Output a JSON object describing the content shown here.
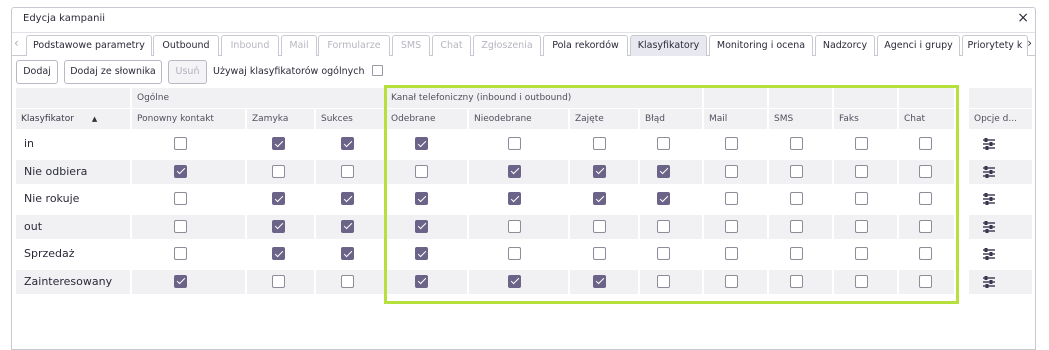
{
  "dialog": {
    "title": "Edycja kampanii",
    "close_symbol": "×"
  },
  "tabs": {
    "nav_left": "‹",
    "nav_right": "›",
    "items": [
      {
        "label": "Podstawowe parametry",
        "disabled": false,
        "active": false
      },
      {
        "label": "Outbound",
        "disabled": false,
        "active": false
      },
      {
        "label": "Inbound",
        "disabled": true,
        "active": false
      },
      {
        "label": "Mail",
        "disabled": true,
        "active": false
      },
      {
        "label": "Formularze",
        "disabled": true,
        "active": false
      },
      {
        "label": "SMS",
        "disabled": true,
        "active": false
      },
      {
        "label": "Chat",
        "disabled": true,
        "active": false
      },
      {
        "label": "Zgłoszenia",
        "disabled": true,
        "active": false
      },
      {
        "label": "Pola rekordów",
        "disabled": false,
        "active": false
      },
      {
        "label": "Klasyfikatory",
        "disabled": false,
        "active": true
      },
      {
        "label": "Monitoring i ocena",
        "disabled": false,
        "active": false
      },
      {
        "label": "Nadzorcy",
        "disabled": false,
        "active": false
      },
      {
        "label": "Agenci i grupy",
        "disabled": false,
        "active": false
      },
      {
        "label": "Priorytety k",
        "disabled": false,
        "active": false
      }
    ]
  },
  "toolbar": {
    "add_label": "Dodaj",
    "add_from_dict_label": "Dodaj ze słownika",
    "delete_label": "Usuń",
    "use_general_label": "Używaj klasyfikatorów ogólnych",
    "use_general_checked": false
  },
  "table": {
    "group_general": "Ogólne",
    "group_phone": "Kanał telefoniczny (inbound i outbound)",
    "sort_symbol": "▲",
    "columns": [
      "Klasyfikator",
      "Ponowny kontakt",
      "Zamyka",
      "Sukces",
      "Odebrane",
      "Nieodebrane",
      "Zajęte",
      "Błąd",
      "Mail",
      "SMS",
      "Faks",
      "Chat",
      "Opcje d..."
    ],
    "rows": [
      {
        "name": "in",
        "checks": [
          false,
          true,
          true,
          true,
          false,
          false,
          false,
          false,
          false,
          false,
          false
        ]
      },
      {
        "name": "Nie odbiera",
        "checks": [
          true,
          false,
          false,
          false,
          true,
          true,
          true,
          false,
          false,
          false,
          false
        ]
      },
      {
        "name": "Nie rokuje",
        "checks": [
          false,
          true,
          true,
          true,
          true,
          true,
          true,
          false,
          false,
          false,
          false
        ]
      },
      {
        "name": "out",
        "checks": [
          false,
          true,
          true,
          true,
          false,
          false,
          false,
          false,
          false,
          false,
          false
        ]
      },
      {
        "name": "Sprzedaż",
        "checks": [
          false,
          true,
          true,
          true,
          false,
          false,
          false,
          false,
          false,
          false,
          false
        ]
      },
      {
        "name": "Zainteresowany",
        "checks": [
          true,
          false,
          false,
          true,
          true,
          true,
          false,
          false,
          false,
          false,
          false
        ]
      }
    ]
  },
  "colors": {
    "checkbox_checked": "#6c6388",
    "highlight_border": "#b6e13d",
    "header_bg": "#f1f1f4"
  },
  "icons": {
    "options": "sliders-icon"
  }
}
